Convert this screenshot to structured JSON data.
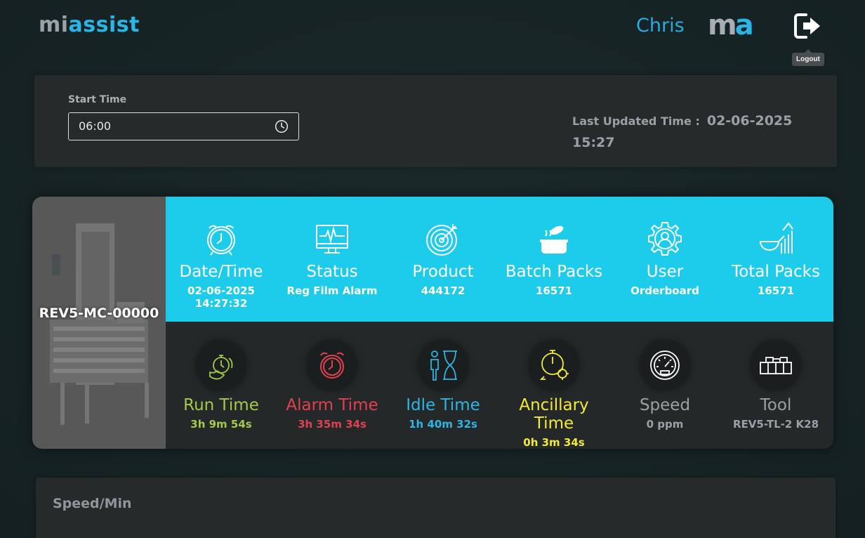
{
  "header": {
    "logo_mi": "mi",
    "logo_assist": "assist",
    "username": "Chris",
    "brand_m": "m",
    "brand_a": "a",
    "logout_tooltip": "Logout"
  },
  "time_panel": {
    "start_label": "Start Time",
    "start_value": "06:00",
    "last_updated_label": "Last Updated Time :",
    "last_updated_value": "02-06-2025 15:27"
  },
  "machine": {
    "name": "REV5-MC-00000",
    "top_stats": [
      {
        "icon": "alarm-clock-icon",
        "title": "Date/Time",
        "value": "02-06-2025 14:27:32"
      },
      {
        "icon": "monitor-pulse-icon",
        "title": "Status",
        "value": "Reg Film Alarm"
      },
      {
        "icon": "target-icon",
        "title": "Product",
        "value": "444172"
      },
      {
        "icon": "cooking-pot-icon",
        "title": "Batch Packs",
        "value": "16571"
      },
      {
        "icon": "user-gear-icon",
        "title": "User",
        "value": "Orderboard"
      },
      {
        "icon": "growth-chart-icon",
        "title": "Total Packs",
        "value": "16571"
      }
    ],
    "bottom_stats": [
      {
        "icon": "stopwatch-hand-icon",
        "title": "Run Time",
        "value": "3h 9m 54s",
        "color": "#a5c94a"
      },
      {
        "icon": "alarm-clock-icon",
        "title": "Alarm Time",
        "value": "3h 35m 34s",
        "color": "#e0414f"
      },
      {
        "icon": "person-hourglass-icon",
        "title": "Idle Time",
        "value": "1h 40m 32s",
        "color": "#2fb4e3"
      },
      {
        "icon": "stopwatch-gear-icon",
        "title": "Ancillary Time",
        "value": "0h 3m 34s",
        "color": "#f2ea3b"
      },
      {
        "icon": "speedometer-icon",
        "title": "Speed",
        "value": "0 ppm",
        "color": "#9aa0a6"
      },
      {
        "icon": "tool-icon",
        "title": "Tool",
        "value": "REV5-TL-2 K28",
        "color": "#9aa0a6"
      }
    ]
  },
  "speed_panel": {
    "title": "Speed/Min"
  }
}
